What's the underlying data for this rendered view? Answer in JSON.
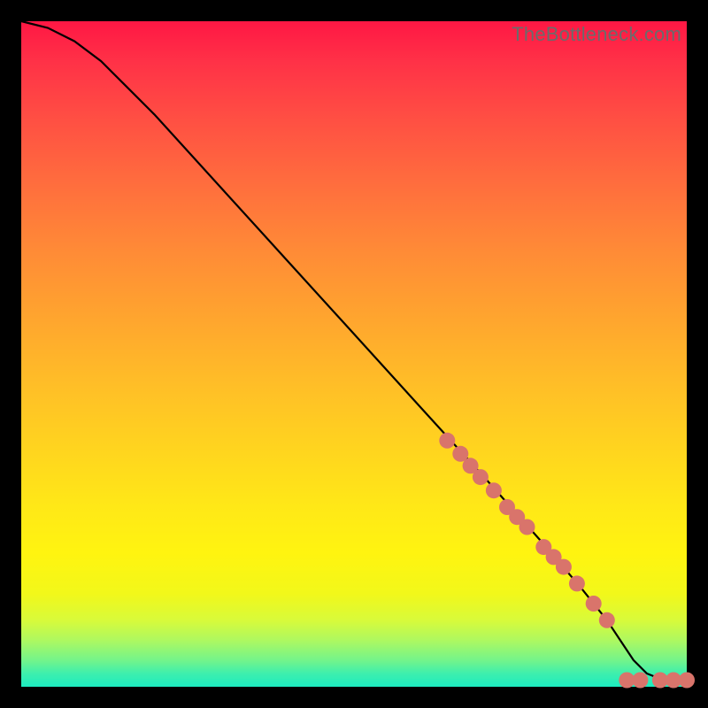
{
  "watermark": "TheBottleneck.com",
  "colors": {
    "curve": "#000000",
    "marker_fill": "#d9746b",
    "marker_stroke": "#cf5f57"
  },
  "chart_data": {
    "type": "line",
    "title": "",
    "xlabel": "",
    "ylabel": "",
    "xlim": [
      0,
      100
    ],
    "ylim": [
      0,
      100
    ],
    "series": [
      {
        "name": "curve",
        "x": [
          0,
          4,
          8,
          12,
          16,
          20,
          30,
          40,
          50,
          60,
          70,
          78,
          84,
          88,
          90,
          92,
          94,
          96,
          98,
          100
        ],
        "y": [
          100,
          99,
          97,
          94,
          90,
          86,
          75,
          64,
          53,
          42,
          31,
          22,
          15,
          10,
          7,
          4,
          2,
          1.2,
          1,
          1
        ]
      }
    ],
    "markers": [
      {
        "x": 64,
        "y": 37
      },
      {
        "x": 66,
        "y": 35
      },
      {
        "x": 67.5,
        "y": 33.2
      },
      {
        "x": 69,
        "y": 31.5
      },
      {
        "x": 71,
        "y": 29.5
      },
      {
        "x": 73,
        "y": 27
      },
      {
        "x": 74.5,
        "y": 25.5
      },
      {
        "x": 76,
        "y": 24
      },
      {
        "x": 78.5,
        "y": 21
      },
      {
        "x": 80,
        "y": 19.5
      },
      {
        "x": 81.5,
        "y": 18
      },
      {
        "x": 83.5,
        "y": 15.5
      },
      {
        "x": 86,
        "y": 12.5
      },
      {
        "x": 88,
        "y": 10
      },
      {
        "x": 91,
        "y": 1
      },
      {
        "x": 93,
        "y": 1
      },
      {
        "x": 96,
        "y": 1
      },
      {
        "x": 98,
        "y": 1
      },
      {
        "x": 100,
        "y": 1
      }
    ],
    "marker_radius": 9
  }
}
